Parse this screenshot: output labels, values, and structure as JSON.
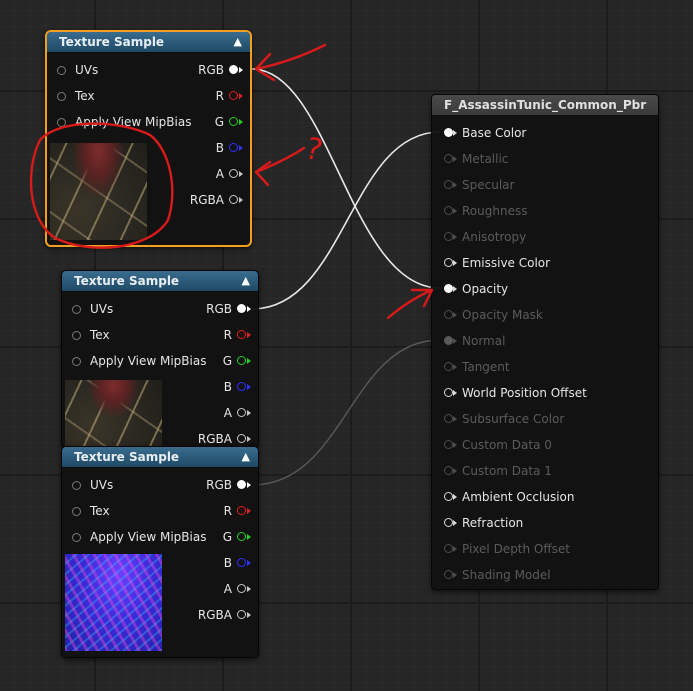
{
  "texture_nodes": [
    {
      "title": "Texture Sample",
      "selected": true,
      "thumbnail": "red-rock-texture",
      "inputs": [
        "UVs",
        "Tex",
        "Apply View MipBias"
      ],
      "outputs": [
        {
          "label": "RGB",
          "color": "#ffffff"
        },
        {
          "label": "R",
          "color": "#e02020"
        },
        {
          "label": "G",
          "color": "#20d020"
        },
        {
          "label": "B",
          "color": "#3030ff"
        },
        {
          "label": "A",
          "color": "#c8c8c8"
        },
        {
          "label": "RGBA",
          "color": "#c8c8c8"
        }
      ]
    },
    {
      "title": "Texture Sample",
      "selected": false,
      "thumbnail": "red-rock-texture",
      "inputs": [
        "UVs",
        "Tex",
        "Apply View MipBias"
      ],
      "outputs": [
        {
          "label": "RGB",
          "color": "#ffffff"
        },
        {
          "label": "R",
          "color": "#e02020"
        },
        {
          "label": "G",
          "color": "#20d020"
        },
        {
          "label": "B",
          "color": "#3030ff"
        },
        {
          "label": "A",
          "color": "#c8c8c8"
        },
        {
          "label": "RGBA",
          "color": "#c8c8c8"
        }
      ]
    },
    {
      "title": "Texture Sample",
      "selected": false,
      "thumbnail": "normal-map-texture",
      "inputs": [
        "UVs",
        "Tex",
        "Apply View MipBias"
      ],
      "outputs": [
        {
          "label": "RGB",
          "color": "#ffffff"
        },
        {
          "label": "R",
          "color": "#e02020"
        },
        {
          "label": "G",
          "color": "#20d020"
        },
        {
          "label": "B",
          "color": "#3030ff"
        },
        {
          "label": "A",
          "color": "#c8c8c8"
        },
        {
          "label": "RGBA",
          "color": "#c8c8c8"
        }
      ]
    }
  ],
  "material_node": {
    "title": "F_AssassinTunic_Common_Pbr",
    "inputs": [
      {
        "label": "Base Color",
        "enabled": true,
        "connected": true
      },
      {
        "label": "Metallic",
        "enabled": false,
        "connected": false
      },
      {
        "label": "Specular",
        "enabled": false,
        "connected": false
      },
      {
        "label": "Roughness",
        "enabled": false,
        "connected": false
      },
      {
        "label": "Anisotropy",
        "enabled": false,
        "connected": false
      },
      {
        "label": "Emissive Color",
        "enabled": true,
        "connected": false
      },
      {
        "label": "Opacity",
        "enabled": true,
        "connected": true
      },
      {
        "label": "Opacity Mask",
        "enabled": false,
        "connected": false
      },
      {
        "label": "Normal",
        "enabled": false,
        "connected": true
      },
      {
        "label": "Tangent",
        "enabled": false,
        "connected": false
      },
      {
        "label": "World Position Offset",
        "enabled": true,
        "connected": false
      },
      {
        "label": "Subsurface Color",
        "enabled": false,
        "connected": false
      },
      {
        "label": "Custom Data 0",
        "enabled": false,
        "connected": false
      },
      {
        "label": "Custom Data 1",
        "enabled": false,
        "connected": false
      },
      {
        "label": "Ambient Occlusion",
        "enabled": true,
        "connected": false
      },
      {
        "label": "Refraction",
        "enabled": true,
        "connected": false
      },
      {
        "label": "Pixel Depth Offset",
        "enabled": false,
        "connected": false
      },
      {
        "label": "Shading Model",
        "enabled": false,
        "connected": false
      }
    ]
  },
  "annotations": {
    "question_mark": "?",
    "ink_color": "#d81a1a"
  },
  "colors": {
    "wire": "#e8e8e8",
    "wire_dim": "#5a5a5a",
    "selection": "#f0a01e",
    "header": "#2d5a7a"
  }
}
